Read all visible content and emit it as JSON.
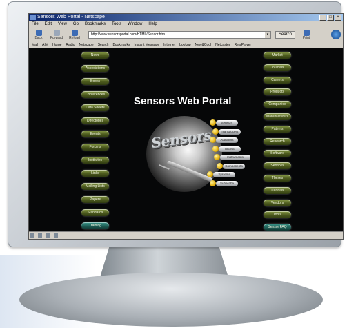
{
  "browser": {
    "title": "Sensors Web Portal - Netscape",
    "window_controls": [
      "_",
      "□",
      "×"
    ],
    "menu": [
      "File",
      "Edit",
      "View",
      "Go",
      "Bookmarks",
      "Tools",
      "Window",
      "Help"
    ],
    "nav_buttons": [
      {
        "label": "Back",
        "icon": "back-arrow-icon"
      },
      {
        "label": "Forward",
        "icon": "forward-arrow-icon"
      },
      {
        "label": "Reload",
        "icon": "reload-icon"
      }
    ],
    "url": "http://www.sensorsportal.com/HTML/Sensor.htm",
    "search_label": "Search",
    "print_label": "Print",
    "links": [
      "Mail",
      "AIM",
      "Home",
      "Radio",
      "Netscape",
      "Search",
      "Bookmarks",
      "Instant Message",
      "Internet",
      "Lookup",
      "New&Cool",
      "Netcaster",
      "RealPlayer"
    ]
  },
  "page": {
    "heading": "Sensors Web Portal",
    "brand": "Sensors",
    "left_menu": [
      "News",
      "Associations",
      "Books",
      "Conferences",
      "Data Sheets",
      "Directories",
      "Events",
      "Forums",
      "Institutes",
      "Links",
      "Mailing Lists",
      "Papers",
      "Standards",
      "Training"
    ],
    "right_menu": [
      "Market",
      "Journals",
      "Careers",
      "Products",
      "Companies",
      "Manufacturers",
      "Patents",
      "Research",
      "Software",
      "Services",
      "Theses",
      "Tutorials",
      "Vendors",
      "Tools",
      "Sensor FAQ"
    ],
    "center_tags": [
      "Sensors",
      "Transducers",
      "Actuators",
      "MEMS",
      "Instruments",
      "Components",
      "Systems",
      "Subscribe"
    ]
  },
  "status": {
    "text": ""
  },
  "colors": {
    "page_bg": "#060708",
    "pill": "#4c5a1e",
    "titlebar": "#0a246a"
  }
}
